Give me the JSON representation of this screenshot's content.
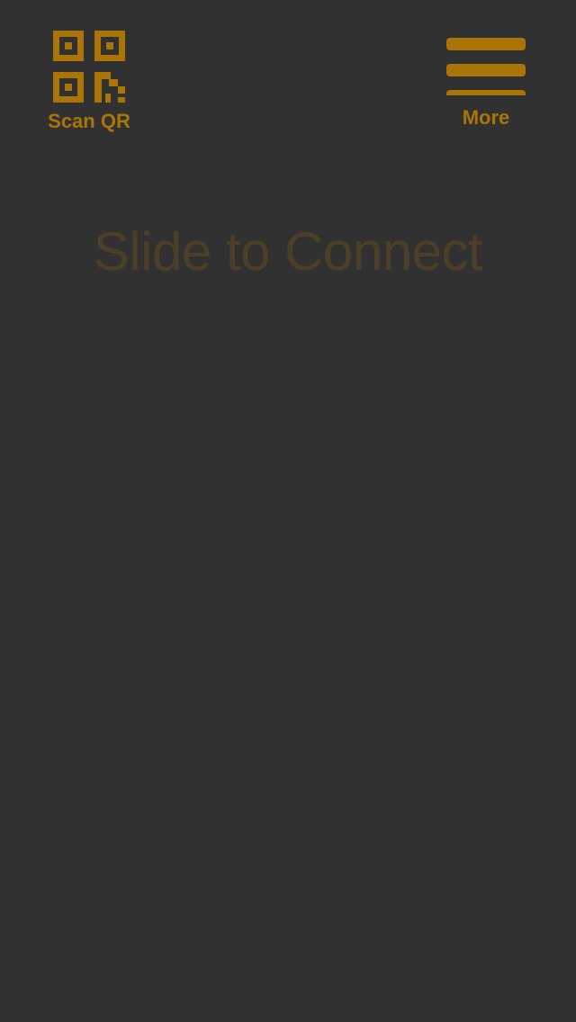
{
  "header": {
    "scan_qr": {
      "label": "Scan QR",
      "icon": "qr-code-icon"
    },
    "more": {
      "label": "More",
      "icon": "hamburger-menu-icon"
    }
  },
  "main": {
    "slide_text": "Slide to Connect"
  },
  "colors": {
    "background": "#313131",
    "accent": "#AB7406",
    "slide_text": "#4C3F27"
  }
}
